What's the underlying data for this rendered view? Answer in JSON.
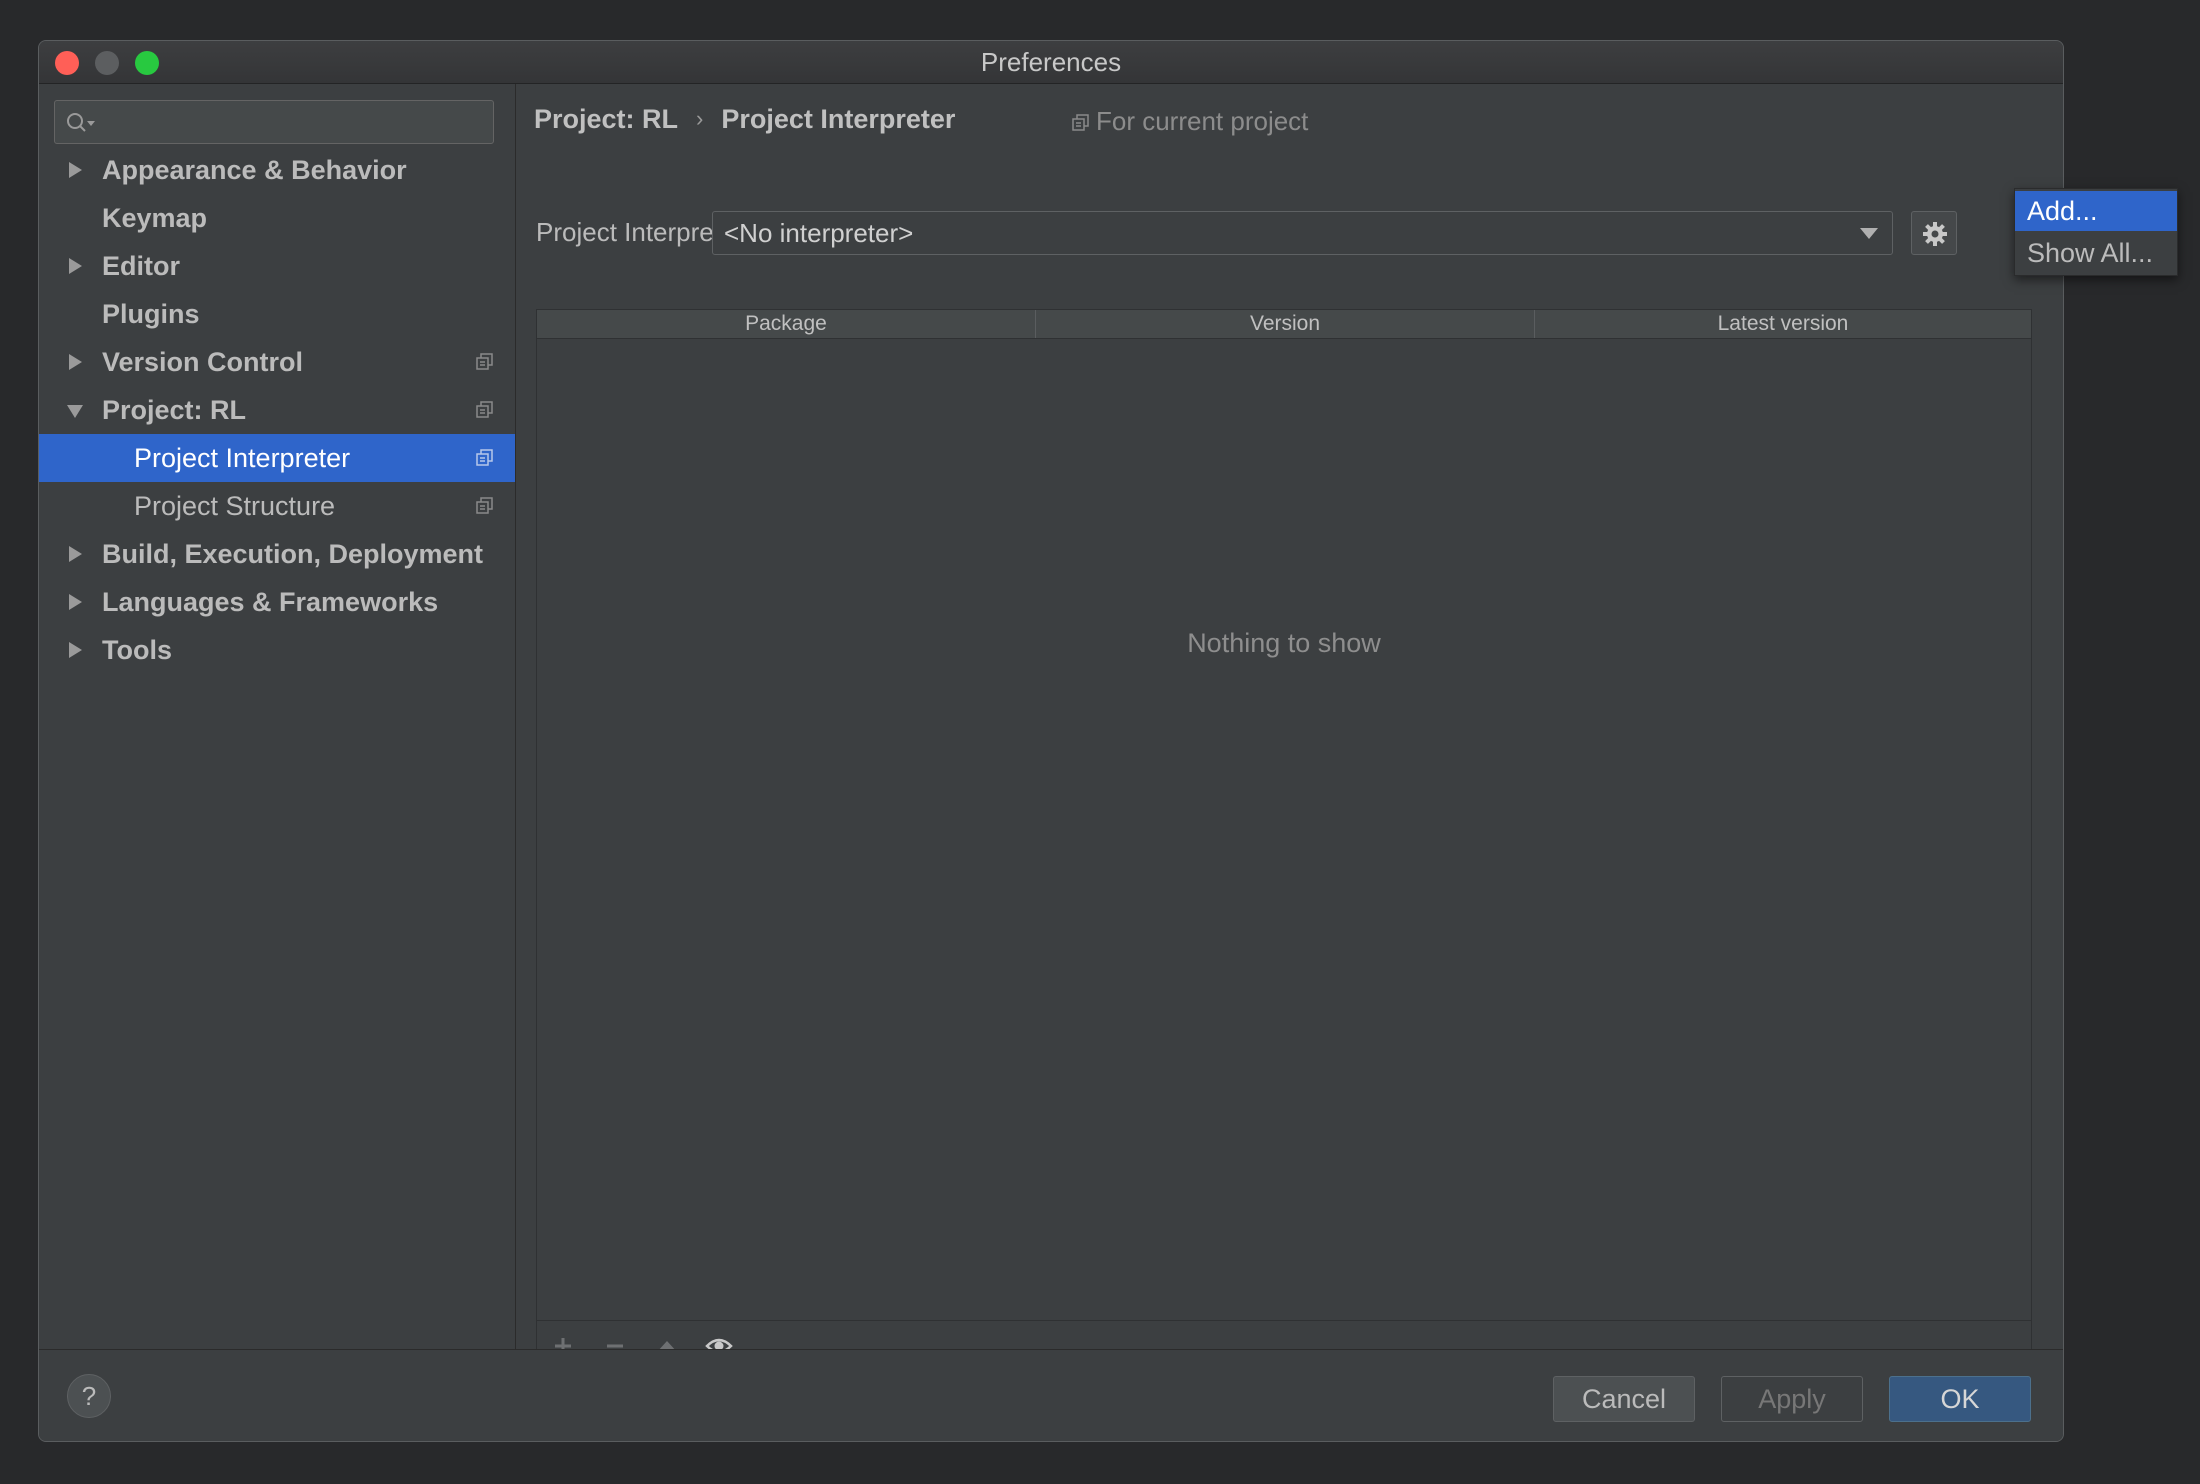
{
  "window": {
    "title": "Preferences"
  },
  "search": {
    "placeholder": ""
  },
  "sidebar": {
    "items": [
      {
        "label": "Appearance & Behavior",
        "expandable": true,
        "expanded": false,
        "bold": true,
        "project_icon": false,
        "selected": false
      },
      {
        "label": "Keymap",
        "expandable": false,
        "bold": true,
        "project_icon": false,
        "selected": false
      },
      {
        "label": "Editor",
        "expandable": true,
        "expanded": false,
        "bold": true,
        "project_icon": false,
        "selected": false
      },
      {
        "label": "Plugins",
        "expandable": false,
        "bold": true,
        "project_icon": false,
        "selected": false
      },
      {
        "label": "Version Control",
        "expandable": true,
        "expanded": false,
        "bold": true,
        "project_icon": true,
        "selected": false
      },
      {
        "label": "Project: RL",
        "expandable": true,
        "expanded": true,
        "bold": true,
        "project_icon": true,
        "selected": false
      },
      {
        "label": "Project Interpreter",
        "child": true,
        "bold": false,
        "project_icon": true,
        "selected": true
      },
      {
        "label": "Project Structure",
        "child": true,
        "bold": false,
        "project_icon": true,
        "selected": false
      },
      {
        "label": "Build, Execution, Deployment",
        "expandable": true,
        "expanded": false,
        "bold": true,
        "project_icon": false,
        "selected": false
      },
      {
        "label": "Languages & Frameworks",
        "expandable": true,
        "expanded": false,
        "bold": true,
        "project_icon": false,
        "selected": false
      },
      {
        "label": "Tools",
        "expandable": true,
        "expanded": false,
        "bold": true,
        "project_icon": false,
        "selected": false
      }
    ]
  },
  "breadcrumb": {
    "parent": "Project: RL",
    "separator": "›",
    "current": "Project Interpreter"
  },
  "scope_hint": "For current project",
  "interpreter": {
    "label": "Project Interpreter:",
    "value": "<No interpreter>"
  },
  "packages_table": {
    "columns": [
      "Package",
      "Version",
      "Latest version"
    ],
    "rows": [],
    "empty_text": "Nothing to show"
  },
  "gear_menu": {
    "items": [
      "Add...",
      "Show All..."
    ],
    "highlighted": "Add..."
  },
  "buttons": {
    "help": "?",
    "cancel": "Cancel",
    "apply": "Apply",
    "ok": "OK"
  },
  "icons": {
    "search": "search-icon",
    "gear": "gear-icon",
    "project": "project-scope-icon",
    "add": "plus-icon",
    "remove": "minus-icon",
    "upgrade": "up-triangle-icon",
    "show": "eye-icon"
  },
  "colors": {
    "accent": "#2f65ca",
    "ok_button": "#365880",
    "background": "#3c3f41"
  }
}
